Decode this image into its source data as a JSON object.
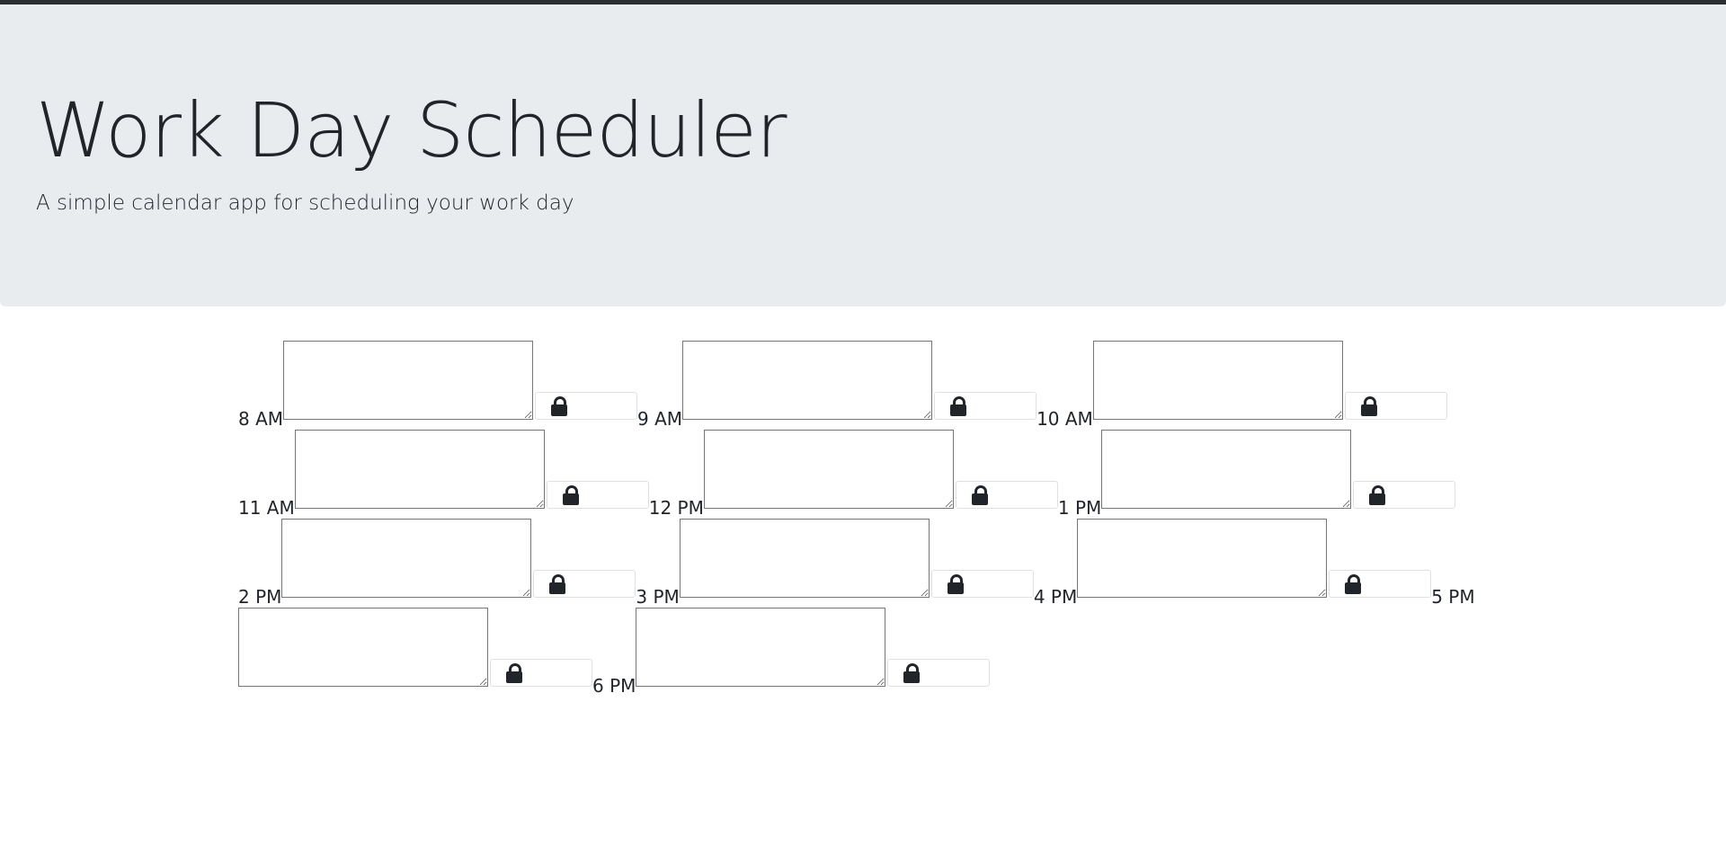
{
  "header": {
    "title": "Work Day Scheduler",
    "subtitle": "A simple calendar app for scheduling your work day"
  },
  "icons": {
    "save": "lock-icon"
  },
  "colors": {
    "jumbotron_bg": "#e9ecef",
    "topbar": "#2b2d31",
    "text": "#212529",
    "textarea_border": "#767676"
  },
  "hours": [
    {
      "label": "8 AM",
      "task": ""
    },
    {
      "label": "9 AM",
      "task": ""
    },
    {
      "label": "10 AM",
      "task": ""
    },
    {
      "label": "11 AM",
      "task": ""
    },
    {
      "label": "12 PM",
      "task": ""
    },
    {
      "label": "1 PM",
      "task": ""
    },
    {
      "label": "2 PM",
      "task": ""
    },
    {
      "label": "3 PM",
      "task": ""
    },
    {
      "label": "4 PM",
      "task": ""
    },
    {
      "label": "5 PM",
      "task": ""
    },
    {
      "label": "6 PM",
      "task": ""
    }
  ]
}
